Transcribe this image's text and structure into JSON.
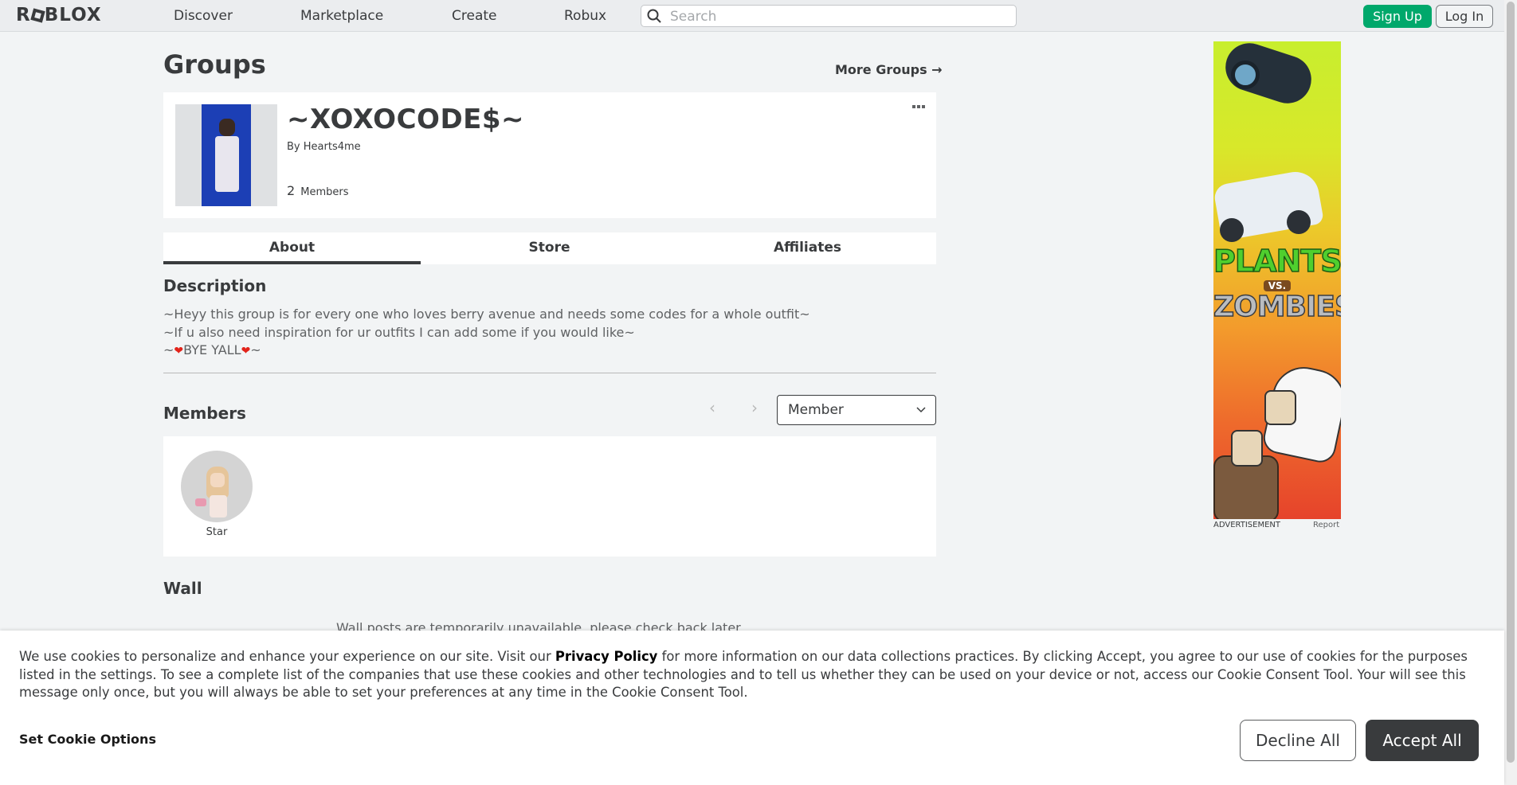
{
  "nav": {
    "logo": "ROBLOX",
    "links": [
      "Discover",
      "Marketplace",
      "Create",
      "Robux"
    ],
    "search_placeholder": "Search",
    "signup_label": "Sign Up",
    "login_label": "Log In"
  },
  "page": {
    "title": "Groups",
    "more_groups": "More Groups →"
  },
  "group": {
    "name": "~XOXOCODE$~",
    "by_label": "By",
    "owner": "Hearts4me",
    "member_count": "2",
    "members_label": "Members"
  },
  "tabs": [
    "About",
    "Store",
    "Affiliates"
  ],
  "about": {
    "description_title": "Description",
    "description_lines": [
      "~Heyy this group is for every one who loves berry avenue and needs some codes for a whole outfit~",
      "~If u also need inspiration for ur outfits I can add some if you would like~",
      "~❤BYE YALL❤~"
    ]
  },
  "members": {
    "title": "Members",
    "role_selected": "Member",
    "list": [
      {
        "name": "Star"
      }
    ]
  },
  "wall": {
    "title": "Wall",
    "message": "Wall posts are temporarily unavailable, please check back later."
  },
  "ad": {
    "label": "ADVERTISEMENT",
    "report": "Report",
    "plants": "PLANTS",
    "vs": "VS.",
    "zombies": "ZOMBIES"
  },
  "cookie": {
    "text_before": "We use cookies to personalize and enhance your experience on our site. Visit our ",
    "privacy_link": "Privacy Policy",
    "text_after": " for more information on our data collections practices. By clicking Accept, you agree to our use of cookies for the purposes listed in the settings. To see a complete list of the companies that use these cookies and other technologies and to tell us whether they can be used on your device or not, access our Cookie Consent Tool. Your will see this message only once, but you will always be able to set your preferences at any time in the Cookie Consent Tool.",
    "set_options": "Set Cookie Options",
    "decline": "Decline All",
    "accept": "Accept All"
  },
  "colors": {
    "signup_green": "#00a86b",
    "accept_dark": "#393b3d",
    "heart_red": "#e2231a"
  }
}
